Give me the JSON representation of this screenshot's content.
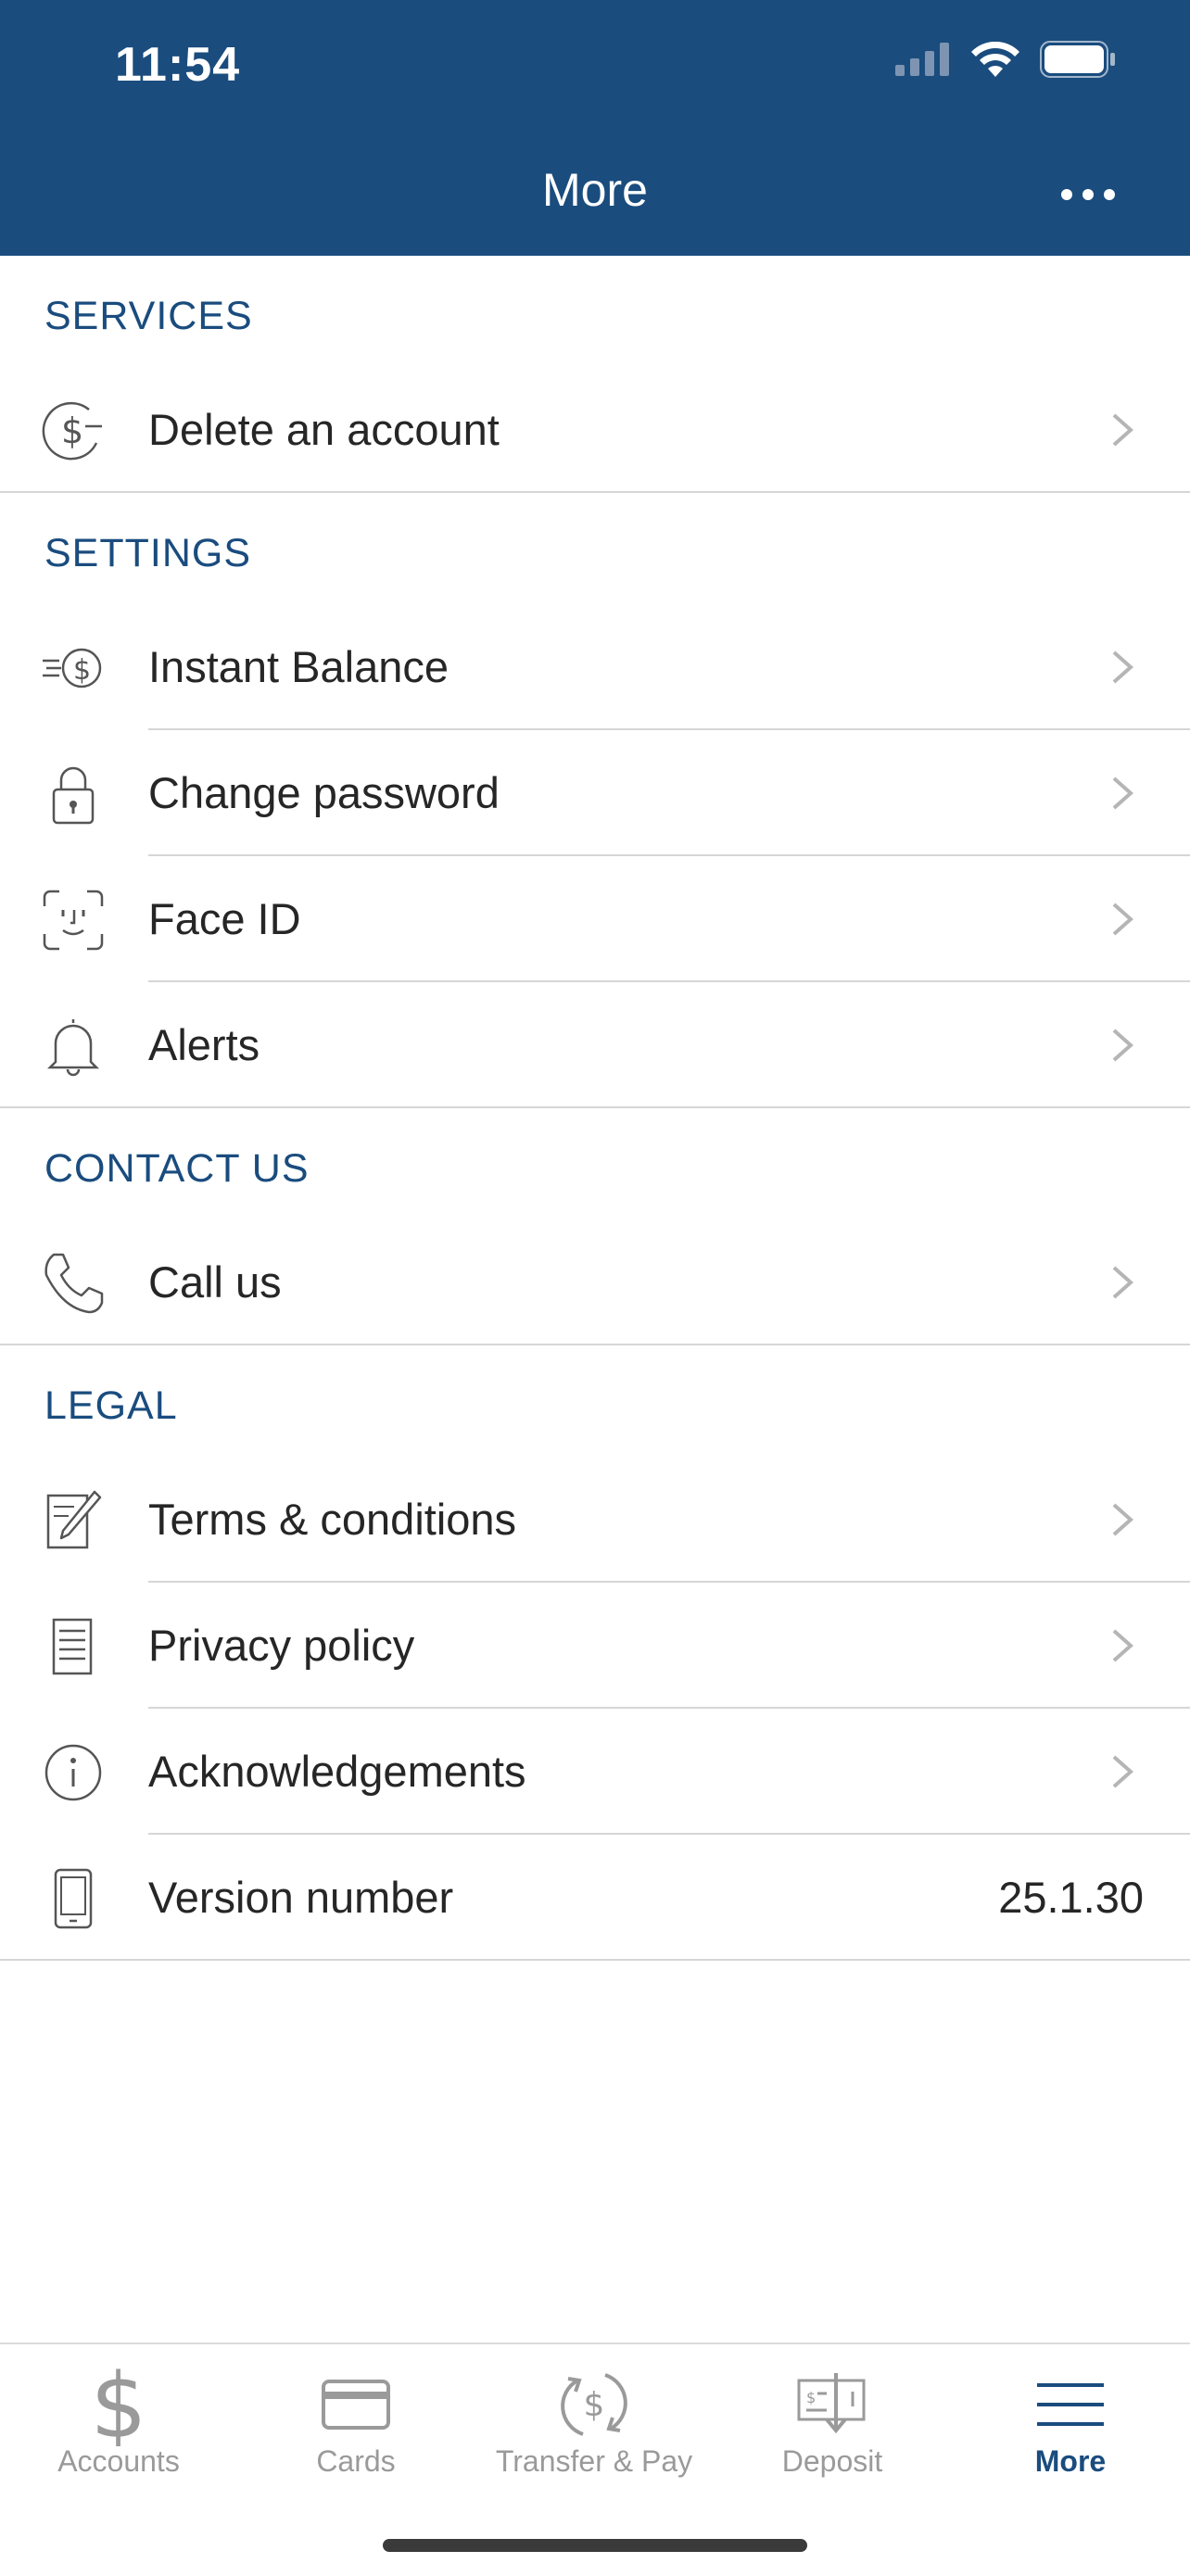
{
  "status_bar": {
    "time": "11:54"
  },
  "header": {
    "title": "More"
  },
  "sections": {
    "services": {
      "title": "SERVICES",
      "items": [
        {
          "label": "Delete an account",
          "icon": "dollar-minus-icon"
        }
      ]
    },
    "settings": {
      "title": "SETTINGS",
      "items": [
        {
          "label": "Instant Balance",
          "icon": "fast-dollar-icon"
        },
        {
          "label": "Change password",
          "icon": "lock-icon"
        },
        {
          "label": "Face ID",
          "icon": "face-id-icon"
        },
        {
          "label": "Alerts",
          "icon": "bell-icon"
        }
      ]
    },
    "contact": {
      "title": "CONTACT US",
      "items": [
        {
          "label": "Call us",
          "icon": "phone-icon"
        }
      ]
    },
    "legal": {
      "title": "LEGAL",
      "items": [
        {
          "label": "Terms & conditions",
          "icon": "document-edit-icon"
        },
        {
          "label": "Privacy policy",
          "icon": "document-icon"
        },
        {
          "label": "Acknowledgements",
          "icon": "info-icon"
        },
        {
          "label": "Version number",
          "value": "25.1.30",
          "icon": "phone-device-icon"
        }
      ]
    }
  },
  "tabbar": {
    "items": [
      {
        "label": "Accounts",
        "icon": "dollar-icon"
      },
      {
        "label": "Cards",
        "icon": "card-icon"
      },
      {
        "label": "Transfer & Pay",
        "icon": "transfer-icon"
      },
      {
        "label": "Deposit",
        "icon": "deposit-check-icon"
      },
      {
        "label": "More",
        "icon": "menu-icon",
        "active": true
      }
    ]
  },
  "colors": {
    "brand": "#1a4c7e",
    "icon_gray": "#555555",
    "chevron": "#b5b5b5",
    "inactive_tab": "#9a9a9a"
  }
}
